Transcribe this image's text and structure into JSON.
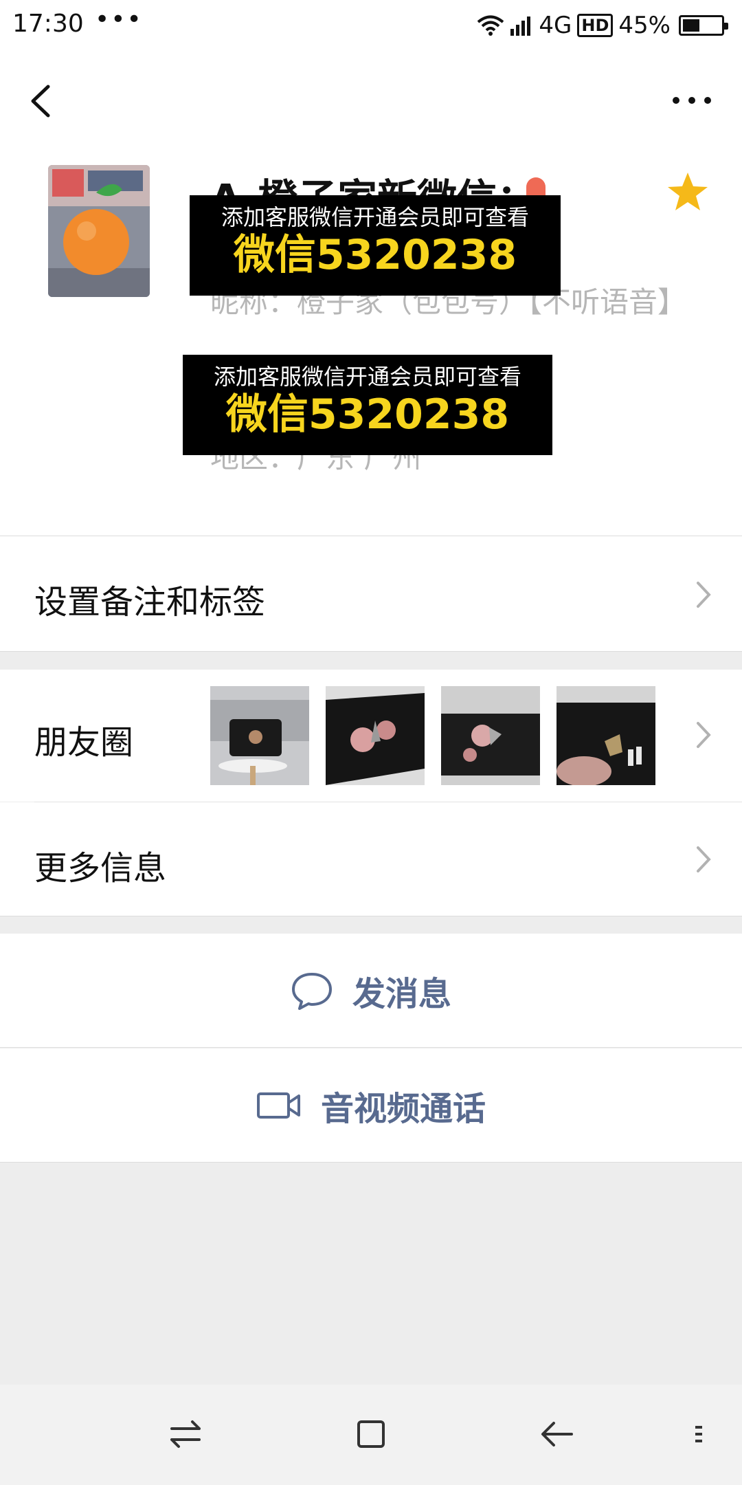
{
  "status_bar": {
    "time": "17:30",
    "dots": "•••",
    "network": "4G",
    "hd": "HD",
    "battery_percent": "45%",
    "battery_level": 0.45
  },
  "profile": {
    "name": "A-橙子家新微信：",
    "nickname": "昵称：橙子家（包包号）【不听语音】",
    "region": "地区：广东 广州"
  },
  "ad_overlays": [
    {
      "line1": "添加客服微信开通会员即可查看",
      "line2": "微信5320238"
    },
    {
      "line1": "添加客服微信开通会员即可查看",
      "line2": "微信5320238"
    }
  ],
  "cells": {
    "remark": "设置备注和标签",
    "moments": "朋友圈",
    "more_info": "更多信息"
  },
  "actions": {
    "message": "发消息",
    "call": "音视频通话"
  },
  "colors": {
    "accent_link": "#586a8f",
    "star": "#f5b919",
    "ad_highlight": "#f7d51e"
  }
}
